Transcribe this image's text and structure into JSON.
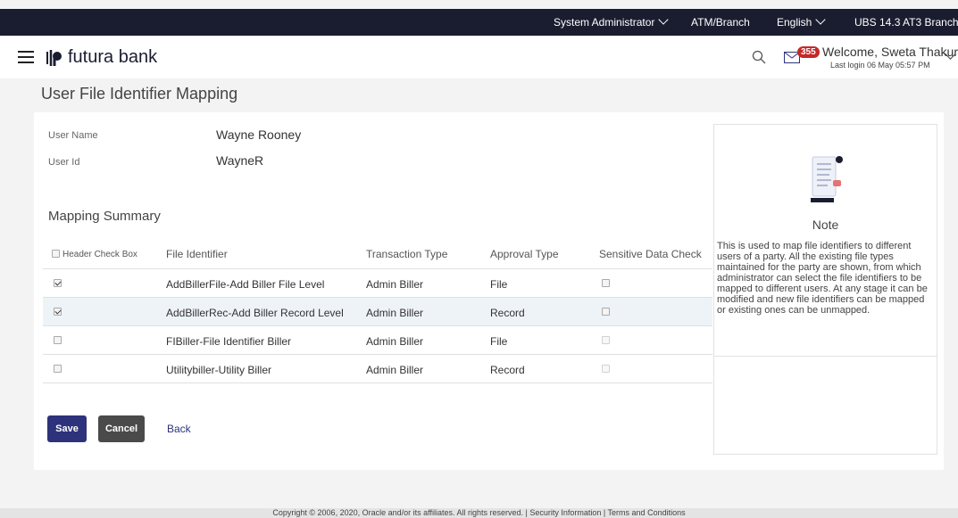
{
  "topbar": {
    "role": "System Administrator",
    "atm_branch": "ATM/Branch",
    "language": "English",
    "branch": "UBS 14.3 AT3 Branch"
  },
  "header": {
    "brand": "futura bank",
    "notification_count": "355",
    "welcome": "Welcome, Sweta Thakur",
    "last_login": "Last login 06 May 05:57 PM"
  },
  "page": {
    "title": "User File Identifier Mapping"
  },
  "user": {
    "name_label": "User Name",
    "name_value": "Wayne Rooney",
    "id_label": "User Id",
    "id_value": "WayneR"
  },
  "mapping": {
    "title": "Mapping Summary",
    "headers": [
      "Header Check Box",
      "File Identifier",
      "Transaction Type",
      "Approval Type",
      "Sensitive Data Check"
    ],
    "rows": [
      {
        "checked": true,
        "file_identifier": "AddBillerFile-Add Biller File Level",
        "transaction_type": "Admin Biller",
        "approval_type": "File",
        "sensitive": false,
        "sensitive_disabled": false
      },
      {
        "checked": true,
        "file_identifier": "AddBillerRec-Add Biller Record Level",
        "transaction_type": "Admin Biller",
        "approval_type": "Record",
        "sensitive": false,
        "sensitive_disabled": false
      },
      {
        "checked": false,
        "file_identifier": "FIBiller-File Identifier Biller",
        "transaction_type": "Admin Biller",
        "approval_type": "File",
        "sensitive": false,
        "sensitive_disabled": true
      },
      {
        "checked": false,
        "file_identifier": "Utilitybiller-Utility Biller",
        "transaction_type": "Admin Biller",
        "approval_type": "Record",
        "sensitive": false,
        "sensitive_disabled": true
      }
    ]
  },
  "actions": {
    "save": "Save",
    "cancel": "Cancel",
    "back": "Back"
  },
  "note": {
    "title": "Note",
    "text": "This is used to map file identifiers to different users of a party. All the existing file types maintained for the party are shown, from which administrator can select the file identifiers to be mapped to different users. At any stage it can be modified and new file identifiers can be mapped or existing ones can be unmapped."
  },
  "footer": {
    "text": "Copyright © 2006, 2020, Oracle and/or its affiliates. All rights reserved. | Security Information | Terms and Conditions"
  },
  "colors": {
    "topbar": "#1a1d30",
    "primary_button": "#2d327a",
    "secondary_button": "#4a4a4a",
    "badge": "#c62828",
    "highlight_row": "#eef3f8"
  }
}
